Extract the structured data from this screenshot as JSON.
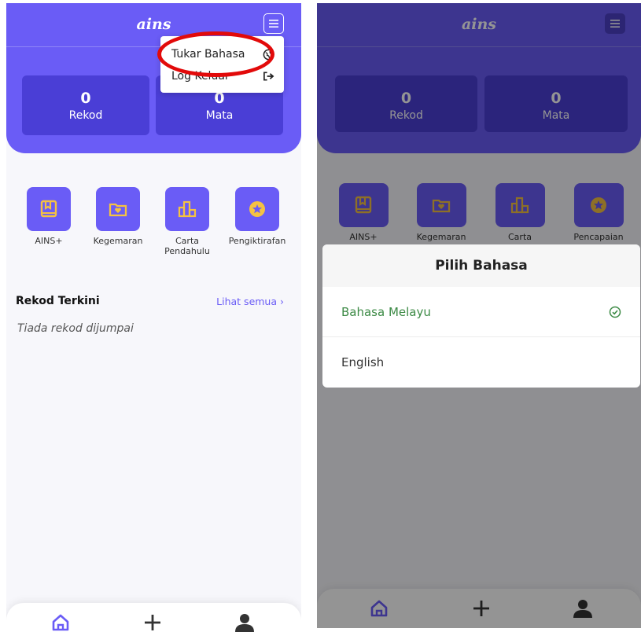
{
  "app": {
    "logo": "ains"
  },
  "stats": [
    {
      "value": "0",
      "label": "Rekod"
    },
    {
      "value": "0",
      "label": "Mata"
    }
  ],
  "left_shortcuts": [
    {
      "label": "AINS+",
      "icon": "book-bookmark-icon"
    },
    {
      "label": "Kegemaran",
      "icon": "heart-folder-icon"
    },
    {
      "label": "Carta Pendahulu",
      "icon": "leaderboard-icon"
    },
    {
      "label": "Pengiktirafan",
      "icon": "star-badge-icon"
    }
  ],
  "right_shortcuts": [
    {
      "label": "AINS+"
    },
    {
      "label": "Kegemaran"
    },
    {
      "label": "Carta"
    },
    {
      "label": "Pencapaian"
    }
  ],
  "recent": {
    "title": "Rekod Terkini",
    "see_all": "Lihat semua",
    "empty": "Tiada rekod dijumpai"
  },
  "menu": [
    {
      "label": "Tukar Bahasa",
      "icon": "globe-icon"
    },
    {
      "label": "Log Keluar",
      "icon": "logout-icon"
    }
  ],
  "language_dialog": {
    "title": "Pilih Bahasa",
    "options": [
      {
        "label": "Bahasa Melayu",
        "selected": true
      },
      {
        "label": "English",
        "selected": false
      }
    ]
  },
  "colors": {
    "primary": "#6a5cf6",
    "card": "#4a3ed6",
    "accent_icon": "#f5c242",
    "selected": "#3c8a45",
    "highlight_ring": "#e20a0a"
  }
}
